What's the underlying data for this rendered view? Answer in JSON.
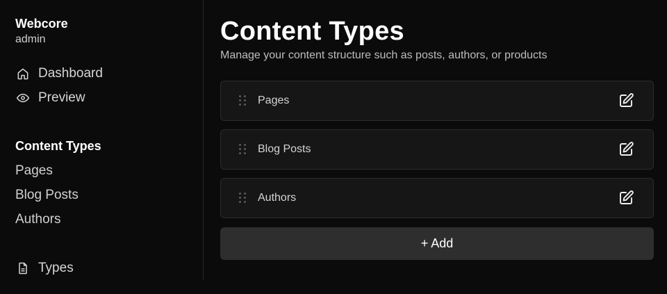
{
  "brand": {
    "name": "Webcore",
    "role": "admin"
  },
  "nav": [
    {
      "label": "Dashboard",
      "icon": "home-icon"
    },
    {
      "label": "Preview",
      "icon": "eye-icon"
    }
  ],
  "content_section": {
    "title": "Content Types",
    "items": [
      "Pages",
      "Blog Posts",
      "Authors"
    ]
  },
  "footer_nav": {
    "label": "Types",
    "icon": "document-icon"
  },
  "main": {
    "title": "Content Types",
    "subtitle": "Manage your content structure such as posts, authors, or products",
    "types": [
      {
        "label": "Pages"
      },
      {
        "label": "Blog Posts"
      },
      {
        "label": "Authors"
      }
    ],
    "add_label": "+ Add"
  },
  "colors": {
    "background": "#0b0b0b",
    "card": "#161616",
    "card_border": "#2c2c2c",
    "button": "#2e2e2e"
  }
}
